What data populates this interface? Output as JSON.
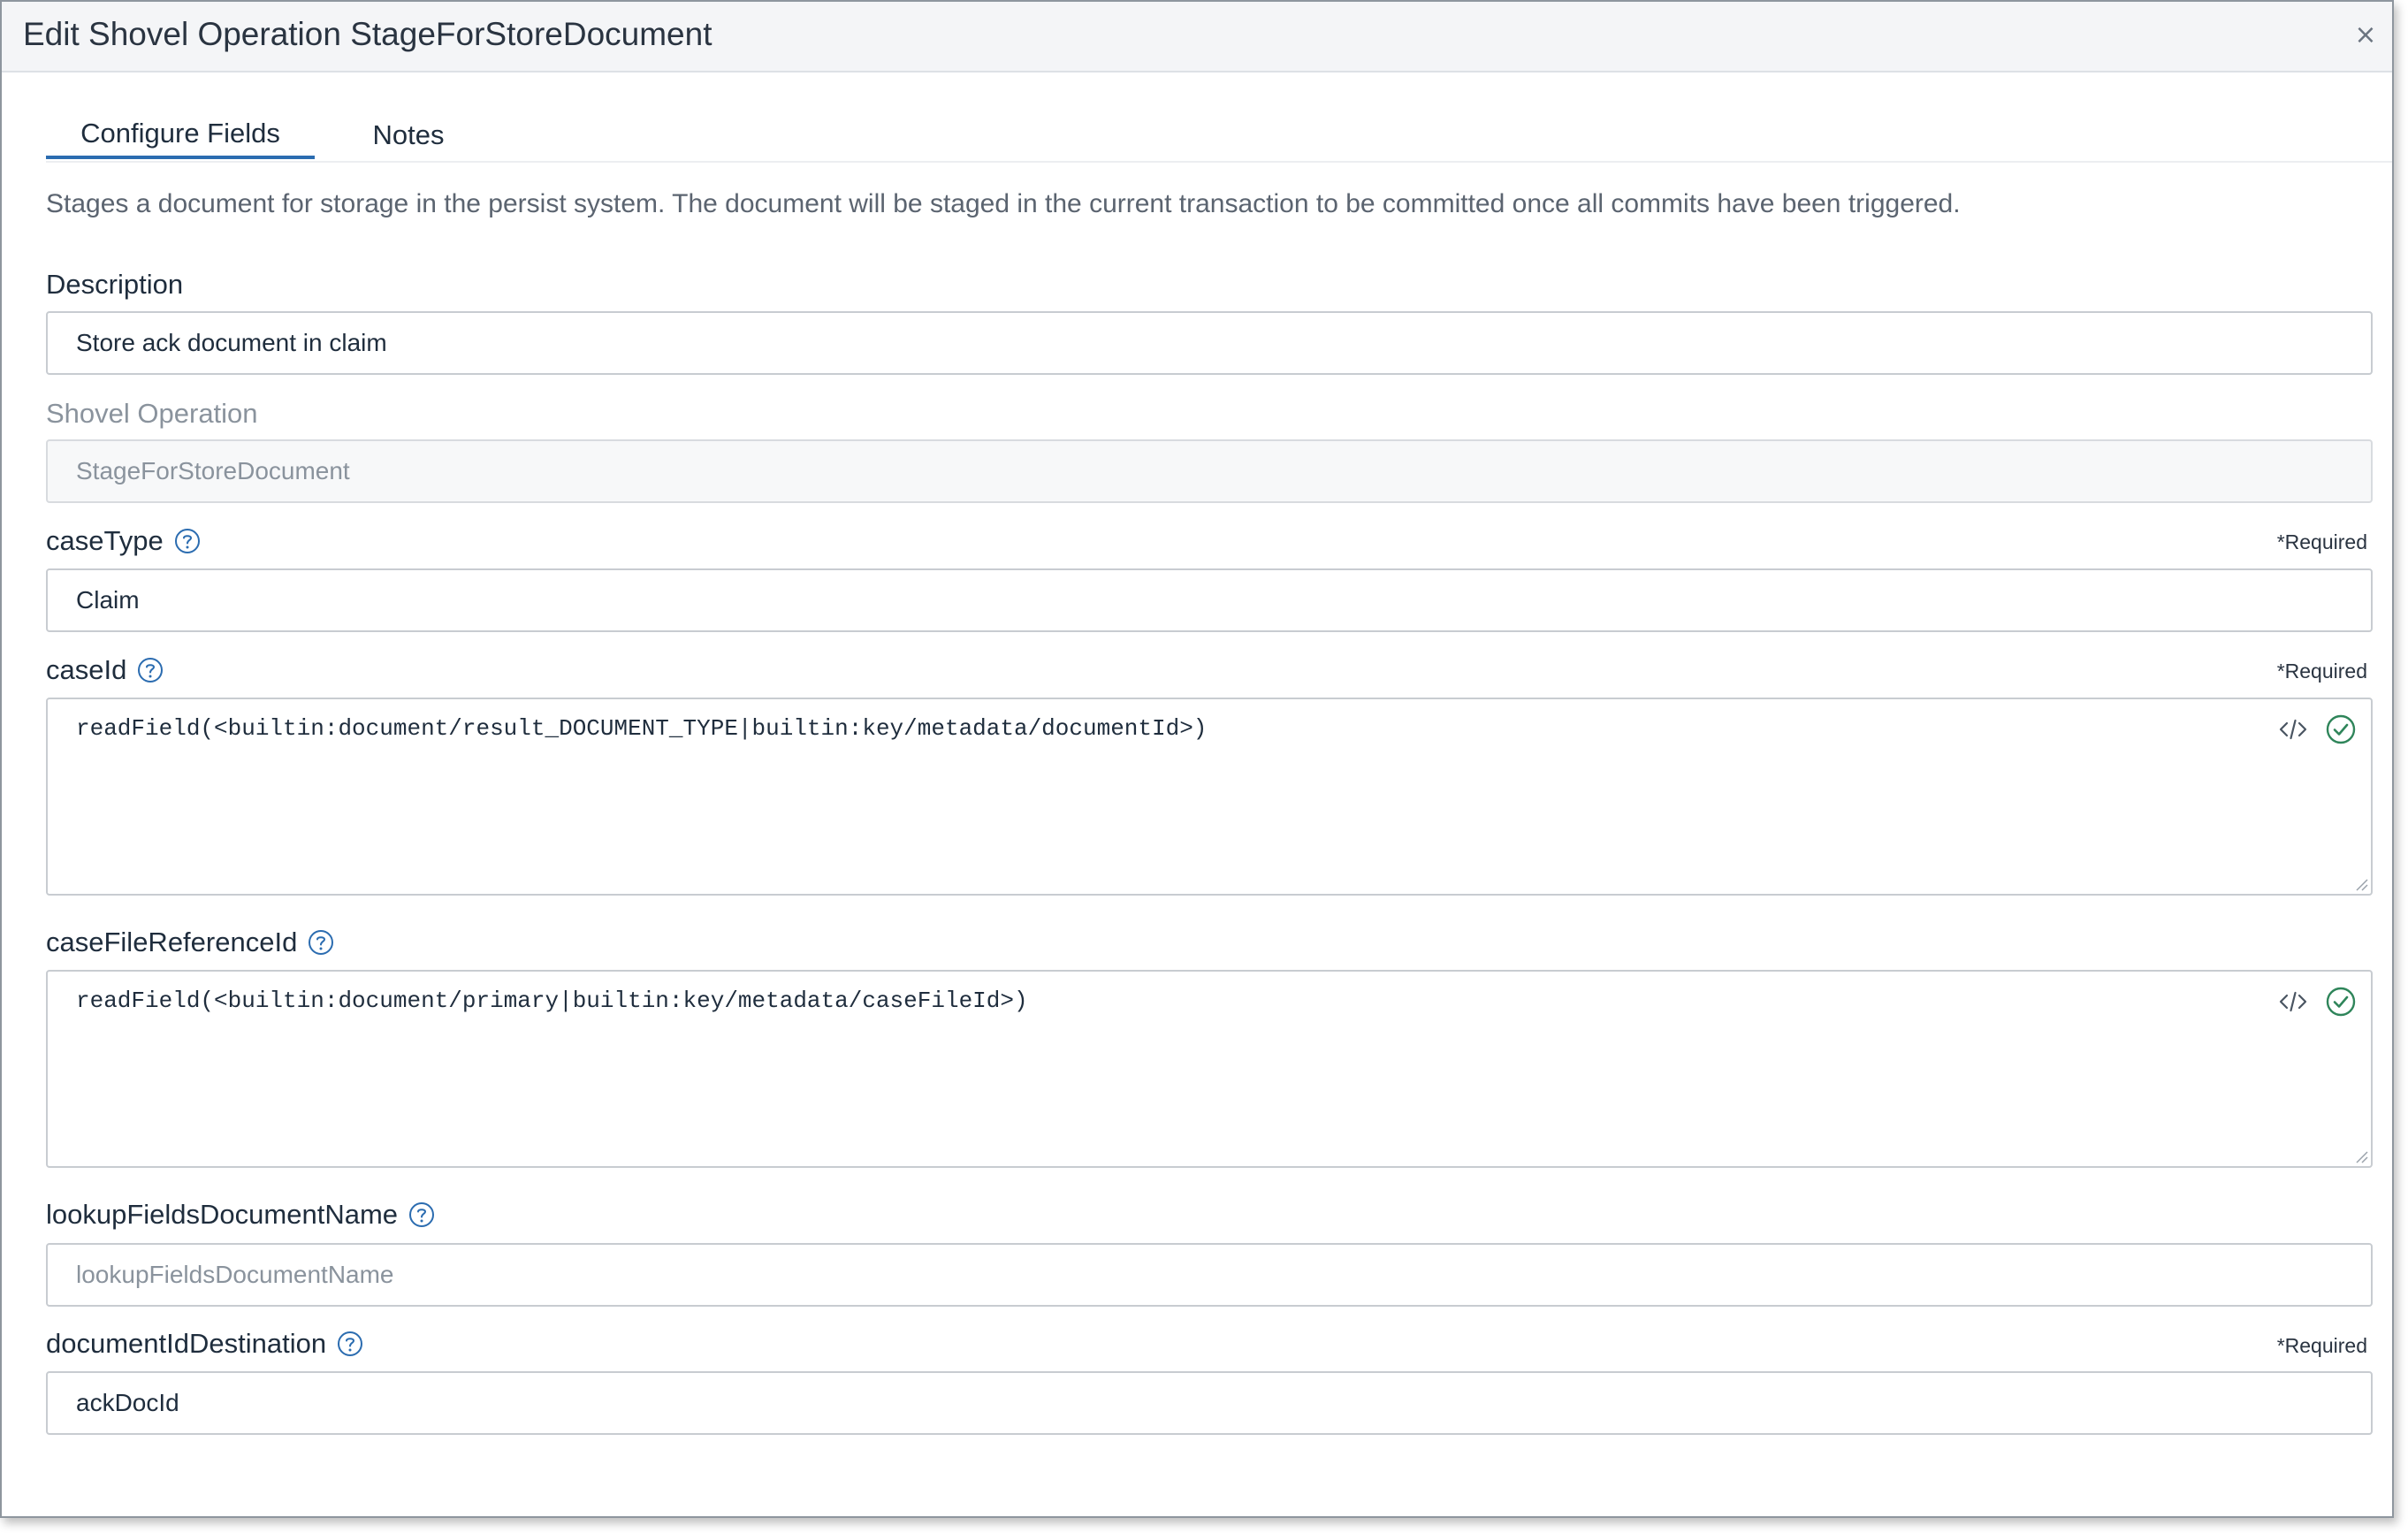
{
  "modal": {
    "title": "Edit Shovel Operation StageForStoreDocument",
    "close_label": "×"
  },
  "tabs": [
    {
      "label": "Configure Fields",
      "active": true
    },
    {
      "label": "Notes",
      "active": false
    }
  ],
  "intro_text": "Stages a document for storage in the persist system. The document will be staged in the current transaction to be committed once all commits have been triggered.",
  "required_label": "*Required",
  "fields": {
    "description": {
      "label": "Description",
      "value": "Store ack document in claim"
    },
    "shovel_operation": {
      "label": "Shovel Operation",
      "placeholder": "StageForStoreDocument"
    },
    "case_type": {
      "label": "caseType",
      "value": "Claim"
    },
    "case_id": {
      "label": "caseId",
      "value": "readField(<builtin:document/result_DOCUMENT_TYPE|builtin:key/metadata/documentId>)"
    },
    "case_file_reference_id": {
      "label": "caseFileReferenceId",
      "value": "readField(<builtin:document/primary|builtin:key/metadata/caseFileId>)"
    },
    "lookup_fields_document_name": {
      "label": "lookupFieldsDocumentName",
      "placeholder": "lookupFieldsDocumentName"
    },
    "document_id_destination": {
      "label": "documentIdDestination",
      "value": "ackDocId"
    }
  },
  "colors": {
    "accent": "#2b6cb0",
    "valid": "#2f855a"
  },
  "icons": {
    "help": "help-circle-icon",
    "code": "code-icon",
    "valid": "check-circle-icon",
    "close": "close-icon"
  }
}
